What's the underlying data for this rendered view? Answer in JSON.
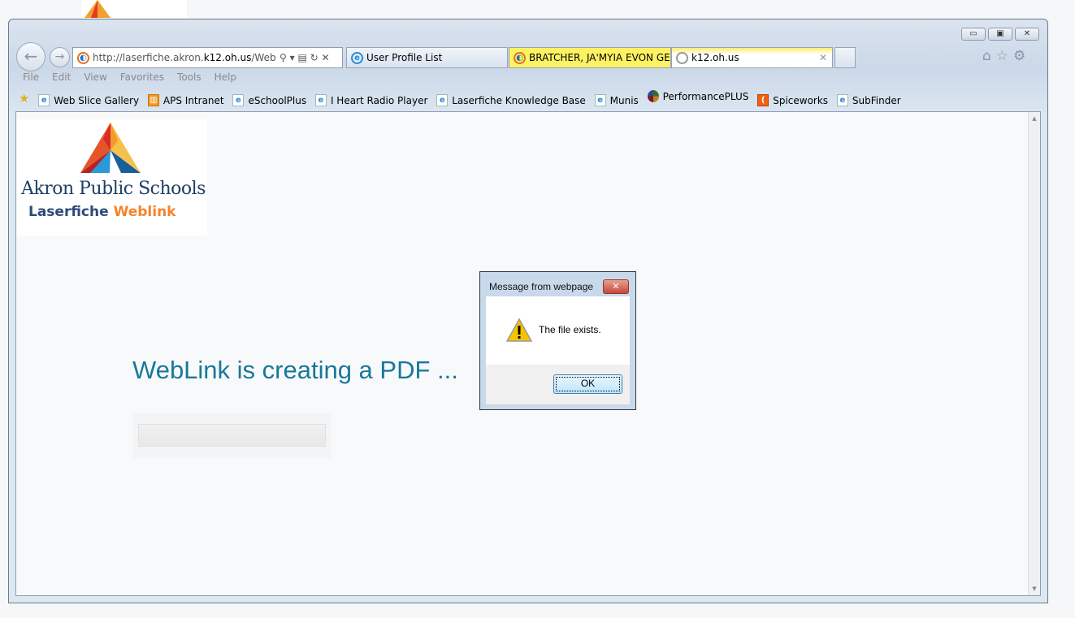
{
  "browser": {
    "address": {
      "prefix": "http://laserfiche.akron.",
      "domain": "k12.oh.us",
      "suffix": "/WebLink"
    },
    "tabs": [
      {
        "label": "User Profile List"
      },
      {
        "label": "BRATCHER, JA'MYIA EVON GE..."
      },
      {
        "label": "k12.oh.us"
      }
    ],
    "menu": [
      "File",
      "Edit",
      "View",
      "Favorites",
      "Tools",
      "Help"
    ],
    "favorites": [
      "Web Slice Gallery",
      "APS Intranet",
      "eSchoolPlus",
      "I Heart Radio Player",
      "Laserfiche Knowledge Base",
      "Munis",
      "PerformancePLUS",
      "Spiceworks",
      "SubFinder"
    ]
  },
  "page": {
    "logo": {
      "line1": "Akron Public Schools",
      "line2a": "Laserfiche ",
      "line2b": "Weblink"
    },
    "heading": "WebLink is creating a PDF ...",
    "progress": 0
  },
  "dialog": {
    "title": "Message from webpage",
    "message": "The file exists.",
    "ok": "OK",
    "close": "✕"
  },
  "colors": {
    "heading": "#17799b",
    "logo_blue": "#1d3f66",
    "logo_orange": "#f6832a"
  }
}
